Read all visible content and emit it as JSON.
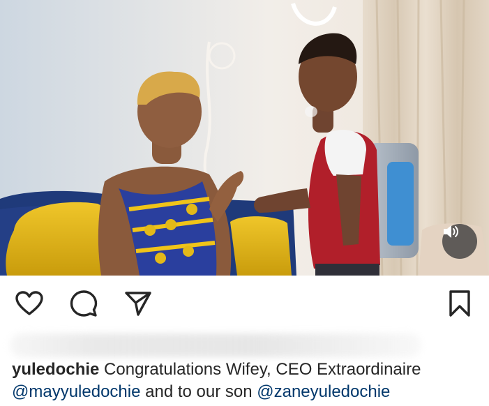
{
  "post": {
    "caption_username": "yuledochie",
    "caption_text": " Congratulations Wifey, CEO Extraordinaire ",
    "mention_1": "@mayyuledochie",
    "caption_text_2": " and to our son ",
    "mention_2": "@zaneyuledochie"
  },
  "media": {
    "type": "video",
    "audio_icon": "speaker-icon"
  },
  "actions": {
    "like_icon": "heart-outline-icon",
    "comment_icon": "comment-bubble-icon",
    "share_icon": "paper-plane-icon",
    "save_icon": "bookmark-outline-icon"
  },
  "colors": {
    "text": "#262626",
    "mention": "#00376b",
    "sofa": "#1f3a7a",
    "cushion": "#e3b919",
    "dress": "#2a3f9e"
  }
}
